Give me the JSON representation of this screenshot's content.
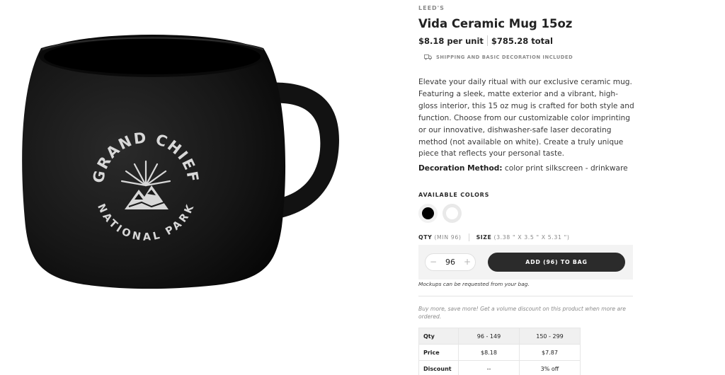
{
  "product": {
    "brand": "LEED'S",
    "title": "Vida Ceramic Mug 15oz",
    "unit_price": "$8.18 per unit",
    "total_price": "$785.28 total",
    "shipping_note": "SHIPPING AND BASIC DECORATION INCLUDED",
    "description": "Elevate your daily ritual with our exclusive ceramic mug. Featuring a sleek, matte exterior and a vibrant, high-gloss interior, this 15 oz mug is crafted for both style and function. Choose from our customizable color imprinting or our innovative, dishwasher-safe laser decorating method (not available on white). Create a truly unique piece that reflects your personal taste.",
    "decoration_label": "Decoration Method:",
    "decoration_value": " color print silkscreen - drinkware",
    "image_logo_text": "GRAND CHIEF NATIONAL PARK"
  },
  "colors": {
    "label": "AVAILABLE COLORS",
    "options": [
      {
        "name": "black",
        "hex": "#000000",
        "selected": true
      },
      {
        "name": "white",
        "hex": "#ffffff",
        "selected": false
      }
    ]
  },
  "order": {
    "qty_label": "QTY",
    "qty_min": "(MIN 96)",
    "size_label": "SIZE",
    "size_value": "(3.38 \" X 3.5 \" X 5.31 \")",
    "minus": "−",
    "plus": "+",
    "quantity": "96",
    "add_button": "ADD (96) TO BAG",
    "mockup_note": "Mockups can be requested from your bag."
  },
  "volume": {
    "note": "Buy more, save more! Get a volume discount on this product when more are ordered.",
    "table": {
      "header": [
        "Qty",
        "96 - 149",
        "150 - 299"
      ],
      "rows": [
        [
          "Price",
          "$8.18",
          "$7.87"
        ],
        [
          "Discount",
          "--",
          "3% off"
        ]
      ]
    }
  },
  "colors_theme": {
    "accent_dark": "#2b2b2b",
    "muted_text": "#8a8a8a"
  }
}
